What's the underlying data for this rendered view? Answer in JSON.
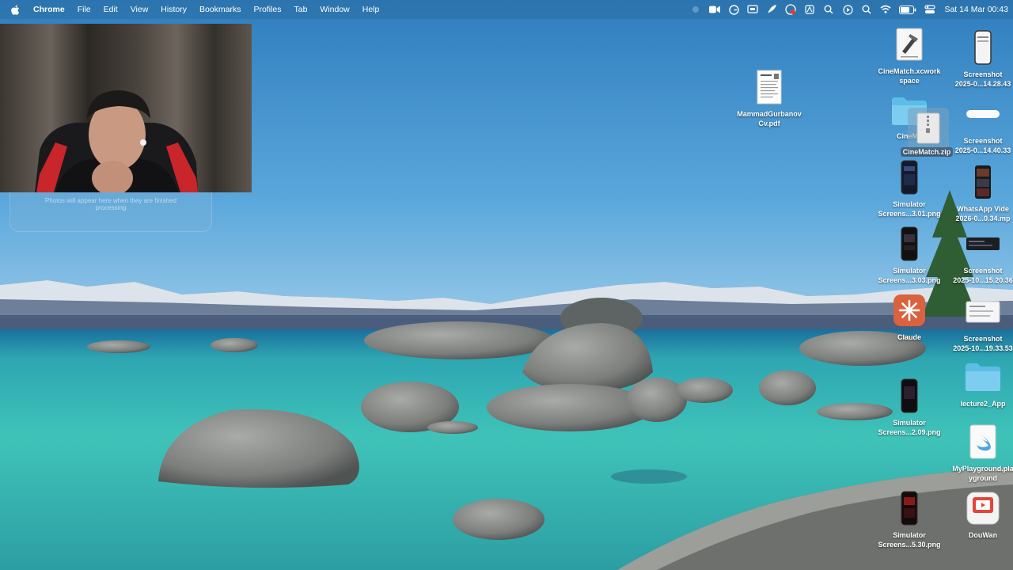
{
  "menubar": {
    "app_name": "Chrome",
    "items": [
      "File",
      "Edit",
      "View",
      "History",
      "Bookmarks",
      "Profiles",
      "Tab",
      "Window",
      "Help"
    ],
    "clock": "Sat 14 Mar  00:43"
  },
  "photos_panel": {
    "message": "Photos will appear here when they are finished processing"
  },
  "desktop": {
    "files": {
      "cv_pdf": "MammadGurbanov\nCv.pdf",
      "cinematch_workspace": "CineMatch.xcwork\nspace",
      "cinematch_folder": "CineMa",
      "cinematch_zip": "CineMatch.zip",
      "sim_301": "Simulator\nScreens...3.01.png",
      "sim_303": "Simulator\nScreens...3.03.png",
      "claude": "Claude",
      "sim_209": "Simulator\nScreens...2.09.png",
      "sim_530": "Simulator\nScreens...5.30.png",
      "ss_1428": "Screenshot\n2025-0...14.28.43",
      "ss_1440": "Screenshot\n2025-0...14.40.33",
      "whatsapp": "WhatsApp Vide\n2026-0...0.34.mp",
      "ss_1520": "Screenshot\n2025-10...15.20.36",
      "ss_1933": "Screenshot\n2025-10...19.33.53",
      "lecture": "lecture2_App",
      "playground": "MyPlayground.pla\nyground",
      "douwan": "DouWan"
    }
  },
  "colors": {
    "sky": "#3f8fc9",
    "water": "#2fb8b4",
    "claude_brand": "#d9623f",
    "folder": "#5bbde8"
  }
}
